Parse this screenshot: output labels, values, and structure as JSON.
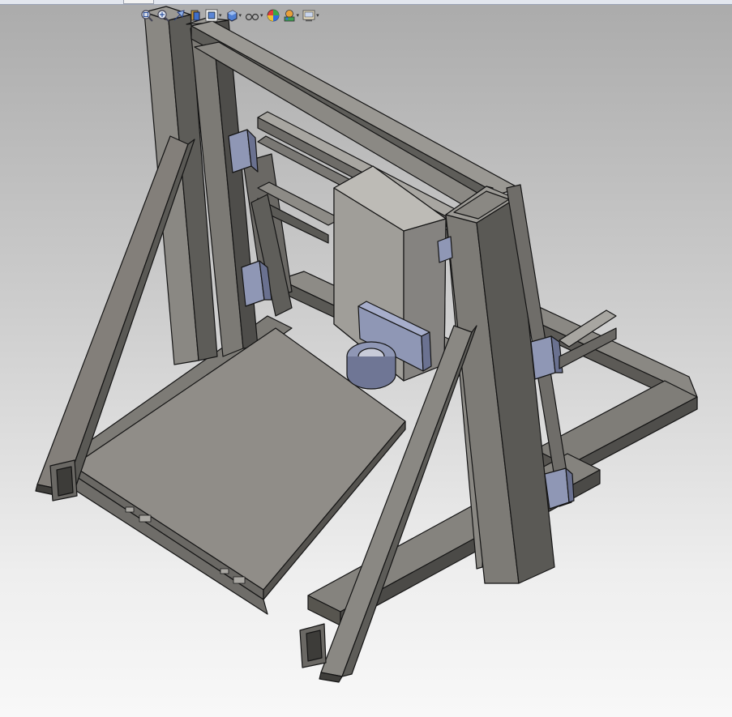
{
  "window": {
    "app": "SolidWorks",
    "view": "isometric-3d-model"
  },
  "heads_up_toolbar": {
    "buttons": [
      {
        "name": "zoom-to-fit",
        "icon": "zoom-to-fit-icon",
        "has_dropdown": false
      },
      {
        "name": "zoom-to-area",
        "icon": "zoom-area-icon",
        "has_dropdown": false
      },
      {
        "name": "previous-view",
        "icon": "previous-view-icon",
        "has_dropdown": false
      },
      {
        "name": "section-view",
        "icon": "section-view-icon",
        "has_dropdown": false
      },
      {
        "name": "view-orientation",
        "icon": "view-orientation-icon",
        "has_dropdown": true
      },
      {
        "name": "display-style",
        "icon": "display-style-icon",
        "has_dropdown": true
      },
      {
        "name": "hide-show-items",
        "icon": "hide-show-icon",
        "has_dropdown": true
      },
      {
        "name": "edit-appearance",
        "icon": "appearance-icon",
        "has_dropdown": false
      },
      {
        "name": "apply-scene",
        "icon": "scene-icon",
        "has_dropdown": true
      },
      {
        "name": "view-settings",
        "icon": "view-settings-icon",
        "has_dropdown": true
      }
    ],
    "dropdown_glyph": "▾"
  },
  "colors": {
    "background_top": "#ababab",
    "background_bottom": "#f8f8f8",
    "frame_steel": "#7f7d78",
    "frame_dark": "#4f4e4b",
    "bed": "#908d88",
    "carriage_plate": "#aeaca7",
    "bracket_blue": "#8f97b5",
    "outline": "#141414"
  }
}
